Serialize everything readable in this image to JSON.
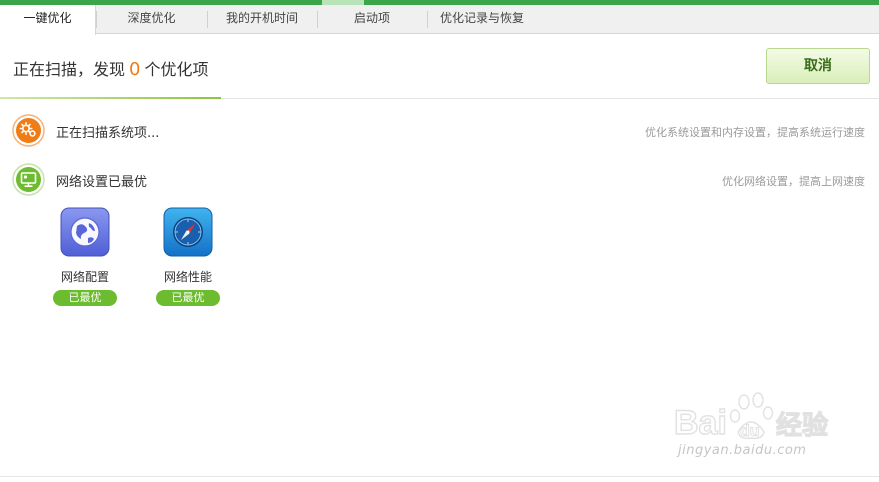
{
  "tabs": [
    {
      "label": "一键优化",
      "active": true
    },
    {
      "label": "深度优化",
      "active": false
    },
    {
      "label": "我的开机时间",
      "active": false
    },
    {
      "label": "启动项",
      "active": false
    },
    {
      "label": "优化记录与恢复",
      "active": false
    }
  ],
  "header": {
    "scan_prefix": "正在扫描，发现",
    "found_count": "0",
    "scan_suffix": "个优化项",
    "cancel_label": "取消"
  },
  "rows": [
    {
      "label": "正在扫描系统项...",
      "desc": "优化系统设置和内存设置，提高系统运行速度",
      "icon": "gears-icon",
      "color": "#f07c15"
    },
    {
      "label": "网络设置已最优",
      "desc": "优化网络设置，提高上网速度",
      "icon": "network-monitor-icon",
      "color": "#6dbb2e"
    }
  ],
  "items": [
    {
      "label": "网络配置",
      "status": "已最优",
      "icon": "globe-icon"
    },
    {
      "label": "网络性能",
      "status": "已最优",
      "icon": "compass-icon"
    }
  ],
  "colors": {
    "accent_green": "#3aa64a",
    "count_orange": "#f07c15",
    "badge_green": "#6dbb2e"
  },
  "watermark": {
    "brand": "Bai",
    "brand_paw": "du",
    "product": "经验",
    "url": "jingyan.baidu.com"
  }
}
